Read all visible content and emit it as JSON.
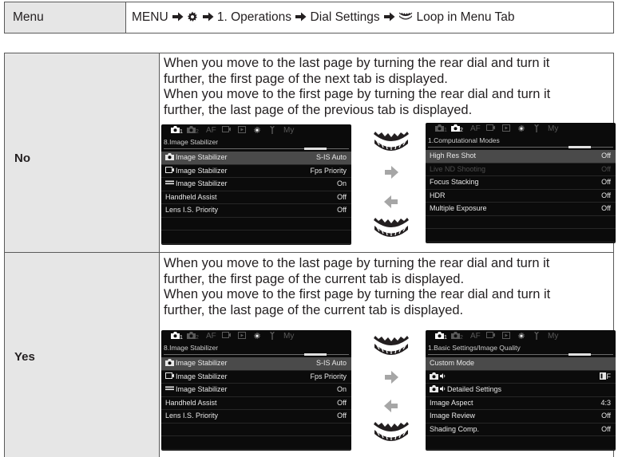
{
  "header": {
    "label": "Menu",
    "path": [
      {
        "type": "text",
        "value": "MENU "
      },
      {
        "type": "icon",
        "value": "right-arrow-icon"
      },
      {
        "type": "text",
        "value": " "
      },
      {
        "type": "icon",
        "value": "gear-icon"
      },
      {
        "type": "text",
        "value": " "
      },
      {
        "type": "icon",
        "value": "right-arrow-icon"
      },
      {
        "type": "text",
        "value": " 1. Operations "
      },
      {
        "type": "icon",
        "value": "right-arrow-icon"
      },
      {
        "type": "text",
        "value": " Dial Settings "
      },
      {
        "type": "icon",
        "value": "right-arrow-icon"
      },
      {
        "type": "text",
        "value": " "
      },
      {
        "type": "icon",
        "value": "dial-icon"
      },
      {
        "type": "text",
        "value": " Loop in Menu Tab"
      }
    ]
  },
  "rows": [
    {
      "label": "No",
      "description_lines": [
        "When you move to the last page by turning the rear dial and turn it",
        "further, the first page of the next tab is displayed.",
        "When you move to the first page by turning the rear dial and turn it",
        "further, the last page of the previous tab is displayed."
      ],
      "left_screen": {
        "tabs": [
          {
            "label": "1",
            "icon": "camera-icon",
            "active": true
          },
          {
            "label": "2",
            "icon": "camera-icon",
            "active": false
          },
          {
            "label": "AF",
            "active": false
          },
          {
            "label": "",
            "icon": "video-icon",
            "active": false
          },
          {
            "label": "",
            "icon": "playback-icon",
            "active": false
          },
          {
            "label": "",
            "icon": "gear-icon",
            "active": false
          },
          {
            "label": "",
            "icon": "wrench-icon",
            "active": false
          },
          {
            "label": "My",
            "active": false
          }
        ],
        "page_title": "8.Image Stabilizer",
        "items": [
          {
            "icon": "camera-icon",
            "label": "Image Stabilizer",
            "value": "S-IS Auto",
            "selected": true
          },
          {
            "icon": "video-icon",
            "label": "Image Stabilizer",
            "value": "Fps Priority"
          },
          {
            "icon": "bar-icon",
            "label": "Image Stabilizer",
            "value": "On"
          },
          {
            "label": "Handheld Assist",
            "value": "Off"
          },
          {
            "label": "Lens I.S. Priority",
            "value": "Off"
          },
          {
            "label": "",
            "value": ""
          },
          {
            "label": "",
            "value": ""
          }
        ]
      },
      "right_screen": {
        "tabs": [
          {
            "label": "1",
            "icon": "camera-icon",
            "active": false
          },
          {
            "label": "2",
            "icon": "camera-icon",
            "active": true
          },
          {
            "label": "AF",
            "active": false
          },
          {
            "label": "",
            "icon": "video-icon",
            "active": false
          },
          {
            "label": "",
            "icon": "playback-icon",
            "active": false
          },
          {
            "label": "",
            "icon": "gear-icon",
            "active": false
          },
          {
            "label": "",
            "icon": "wrench-icon",
            "active": false
          },
          {
            "label": "My",
            "active": false
          }
        ],
        "page_title": "1.Computational Modes",
        "items": [
          {
            "label": "High Res Shot",
            "value": "Off",
            "selected": true
          },
          {
            "label": "Live ND Shooting",
            "value": "Off",
            "dim": true
          },
          {
            "label": "Focus Stacking",
            "value": "Off"
          },
          {
            "label": "HDR",
            "value": "Off"
          },
          {
            "label": "Multiple Exposure",
            "value": "Off"
          },
          {
            "label": "",
            "value": ""
          },
          {
            "label": "",
            "value": ""
          }
        ]
      }
    },
    {
      "label": "Yes",
      "description_lines": [
        "When you move to the last page by turning the rear dial and turn it",
        "further, the first page of the current tab is displayed.",
        "When you move to the first page by turning the rear dial and turn it",
        "further, the last page of the current tab is displayed."
      ],
      "left_screen": {
        "tabs": [
          {
            "label": "1",
            "icon": "camera-icon",
            "active": true
          },
          {
            "label": "2",
            "icon": "camera-icon",
            "active": false
          },
          {
            "label": "AF",
            "active": false
          },
          {
            "label": "",
            "icon": "video-icon",
            "active": false
          },
          {
            "label": "",
            "icon": "playback-icon",
            "active": false
          },
          {
            "label": "",
            "icon": "gear-icon",
            "active": false
          },
          {
            "label": "",
            "icon": "wrench-icon",
            "active": false
          },
          {
            "label": "My",
            "active": false
          }
        ],
        "page_title": "8.Image Stabilizer",
        "items": [
          {
            "icon": "camera-icon",
            "label": "Image Stabilizer",
            "value": "S-IS Auto",
            "selected": true
          },
          {
            "icon": "video-icon",
            "label": "Image Stabilizer",
            "value": "Fps Priority"
          },
          {
            "icon": "bar-icon",
            "label": "Image Stabilizer",
            "value": "On"
          },
          {
            "label": "Handheld Assist",
            "value": "Off"
          },
          {
            "label": "Lens I.S. Priority",
            "value": "Off"
          },
          {
            "label": "",
            "value": ""
          },
          {
            "label": "",
            "value": ""
          }
        ]
      },
      "right_screen": {
        "tabs": [
          {
            "label": "1",
            "icon": "camera-icon",
            "active": true
          },
          {
            "label": "2",
            "icon": "camera-icon",
            "active": false
          },
          {
            "label": "AF",
            "active": false
          },
          {
            "label": "",
            "icon": "video-icon",
            "active": false
          },
          {
            "label": "",
            "icon": "playback-icon",
            "active": false
          },
          {
            "label": "",
            "icon": "gear-icon",
            "active": false
          },
          {
            "label": "",
            "icon": "wrench-icon",
            "active": false
          },
          {
            "label": "My",
            "active": false
          }
        ],
        "page_title": "1.Basic Settings/Image Quality",
        "items": [
          {
            "label": "Custom Mode",
            "value": "",
            "selected": true
          },
          {
            "icon": "camera-sound-icon",
            "label": "",
            "value": "F",
            "value_icon": "quality-icon"
          },
          {
            "icon": "camera-sound-icon",
            "label": "Detailed Settings",
            "value": ""
          },
          {
            "label": "Image Aspect",
            "value": "4:3"
          },
          {
            "label": "Image Review",
            "value": "Off"
          },
          {
            "label": "Shading Comp.",
            "value": "Off"
          },
          {
            "label": "",
            "value": ""
          }
        ]
      }
    }
  ],
  "colors": {
    "label_bg": "#e6e6e6",
    "border": "#5a5a5a",
    "screen_bg": "#0b0b0b",
    "selected_item_bg": "#4a4a4a",
    "arrow_gray": "#a6a6a6",
    "dial_black": "#231f20"
  }
}
